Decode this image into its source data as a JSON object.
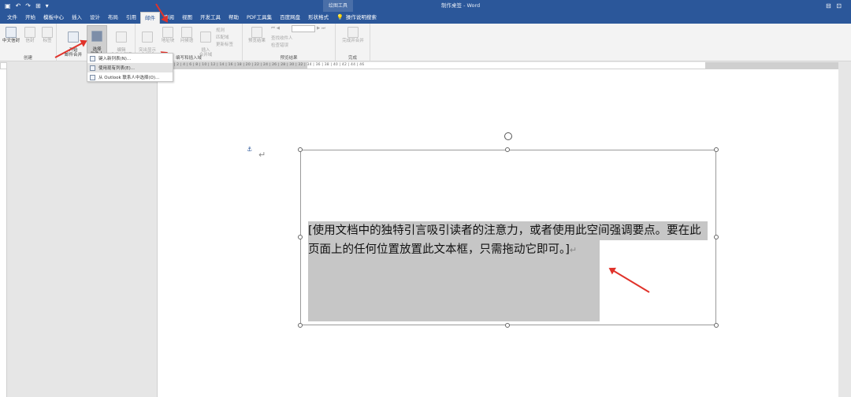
{
  "titlebar": {
    "qat_icons": [
      "save-icon",
      "undo-icon",
      "redo-icon",
      "print-preview-icon"
    ],
    "qat_glyphs": [
      "▣",
      "↶",
      "↷",
      "⊞",
      "▾"
    ],
    "context_tools": "绘图工具",
    "doc_title": "制作桌签 - Word",
    "controls": "⊟ ⊡"
  },
  "tabs": [
    {
      "label": "文件"
    },
    {
      "label": "开始"
    },
    {
      "label": "模板中心"
    },
    {
      "label": "插入"
    },
    {
      "label": "设计"
    },
    {
      "label": "布局"
    },
    {
      "label": "引用"
    },
    {
      "label": "邮件",
      "active": true
    },
    {
      "label": "审阅"
    },
    {
      "label": "视图"
    },
    {
      "label": "开发工具"
    },
    {
      "label": "帮助"
    },
    {
      "label": "PDF工具集"
    },
    {
      "label": "百度网盘"
    },
    {
      "label": "形状格式"
    }
  ],
  "tell_me": "操作说明搜索",
  "ribbon": {
    "groups": [
      {
        "label": "创建"
      },
      {
        "label": "开"
      },
      {
        "label": "编写和插入域"
      },
      {
        "label": "预览结果"
      },
      {
        "label": "完成"
      }
    ],
    "buttons": {
      "chinese_envelope": "中文信封",
      "envelope": "信封",
      "labels": "标签",
      "start_merge": "开始\n邮件合并",
      "select_recipients": "选择\n收件人",
      "edit_list": "编辑\n收件人列表",
      "highlight_fields": "突出显示\n合并域",
      "address_block": "地址块",
      "greeting_line": "问候语",
      "insert_merge_field": "插入\n合并域",
      "rules": "规则",
      "match_fields": "匹配域",
      "update_labels": "更新标签",
      "preview_results": "预览结果",
      "find_recipient": "查找收件人",
      "check_errors": "检查错误",
      "finish_merge": "完成并合并"
    }
  },
  "dropdown": {
    "items": [
      {
        "label": "键入新列表(N)..."
      },
      {
        "label": "使用现有列表(E)...",
        "highlighted": true
      },
      {
        "label": "从 Outlook 联系人中选择(O)..."
      }
    ]
  },
  "ruler": {
    "ticks": "4 | 2 | 1 | 2 | 4 | 6 | 8 | 10 | 12 | 14 | 16 | 18 | 20 | 22 | 24 | 26 | 28 | 30 | 32 | 34 | 36 | 38 | 40 | 42 | 44 | 46"
  },
  "document": {
    "anchor": "⚓",
    "paragraph_mark": "↵",
    "textbox_text": "[使用文档中的独特引言吸引读者的注意力，或者使用此空间强调要点。要在此页面上的任何位置放置此文本框，只需拖动它即可。]",
    "textbox_enter": "↵"
  },
  "colors": {
    "accent": "#2b579a",
    "arrow": "#e0322a",
    "selection": "#c6c6c6"
  }
}
